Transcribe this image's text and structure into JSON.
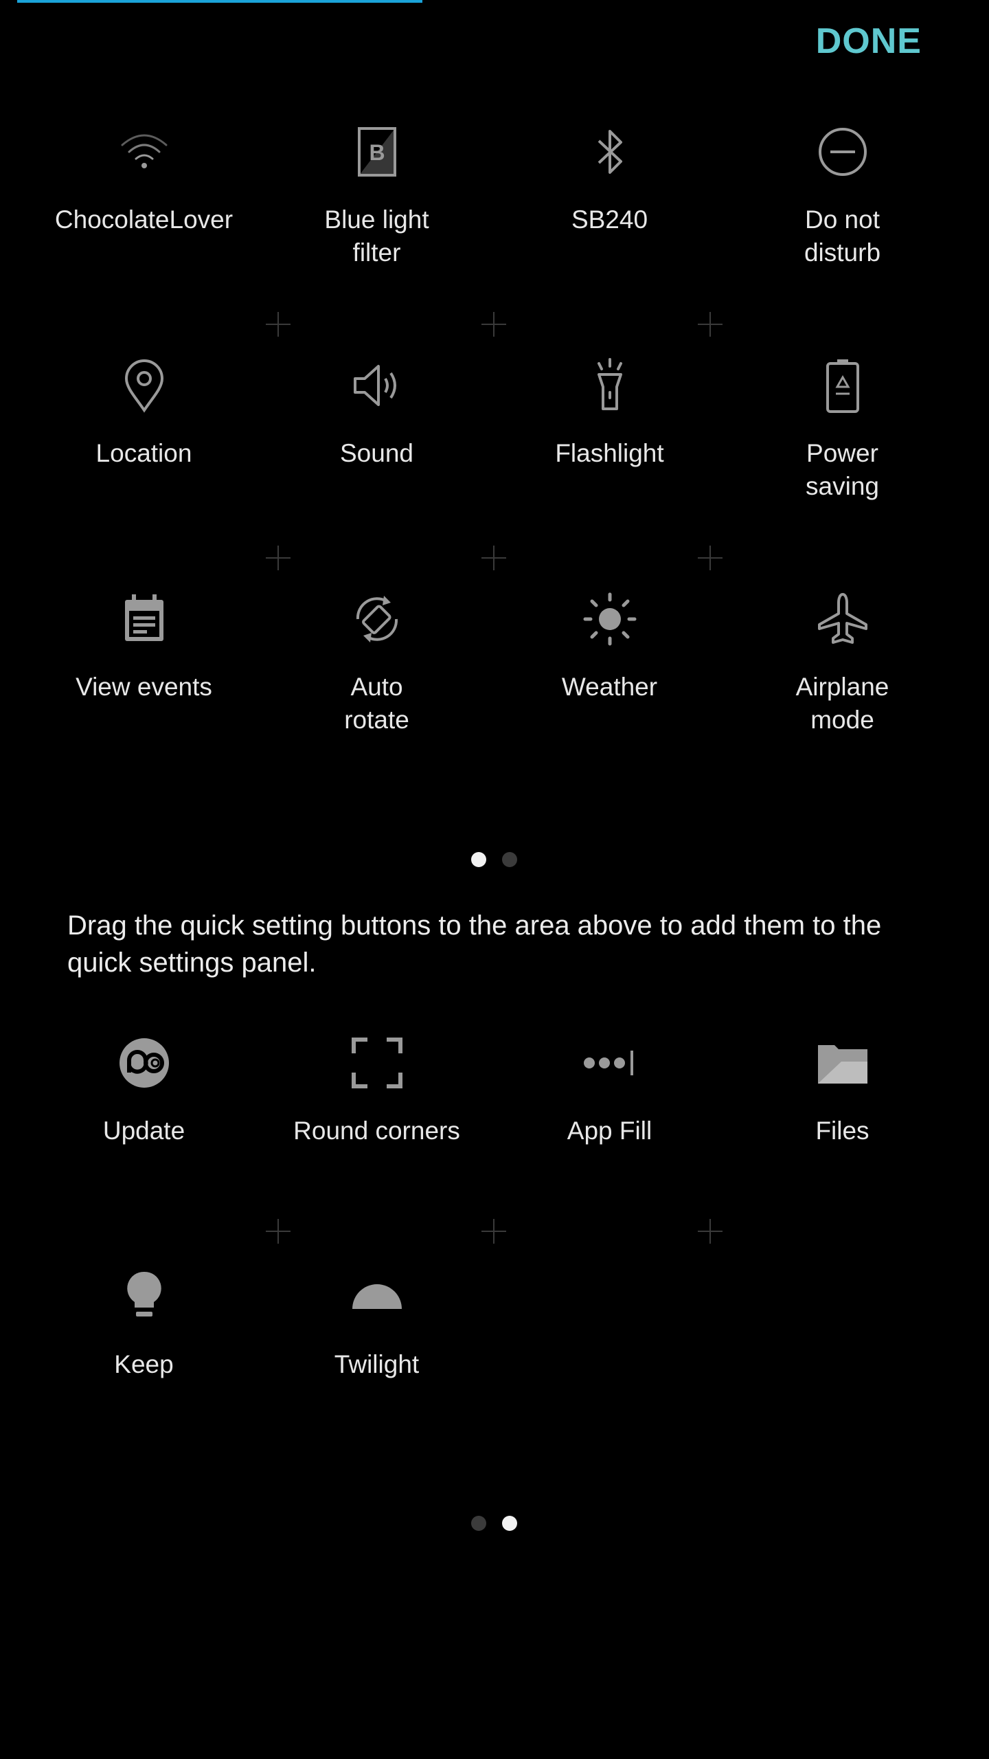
{
  "header": {
    "progress": 0.41,
    "done_label": "DONE"
  },
  "active_tiles": [
    {
      "label": "ChocolateLover",
      "icon": "wifi-icon"
    },
    {
      "label": "Blue light\nfilter",
      "icon": "blue-light-filter-icon"
    },
    {
      "label": "SB240",
      "icon": "bluetooth-icon"
    },
    {
      "label": "Do not\ndisturb",
      "icon": "do-not-disturb-icon"
    },
    {
      "label": "Location",
      "icon": "location-icon"
    },
    {
      "label": "Sound",
      "icon": "sound-icon"
    },
    {
      "label": "Flashlight",
      "icon": "flashlight-icon"
    },
    {
      "label": "Power\nsaving",
      "icon": "power-saving-icon"
    },
    {
      "label": "View events",
      "icon": "calendar-icon"
    },
    {
      "label": "Auto\nrotate",
      "icon": "auto-rotate-icon"
    },
    {
      "label": "Weather",
      "icon": "weather-icon"
    },
    {
      "label": "Airplane\nmode",
      "icon": "airplane-icon"
    }
  ],
  "top_pager": {
    "pages": 2,
    "active": 0
  },
  "instructions": "Drag the quick setting buttons to the area above to add them to the quick settings panel.",
  "available_tiles": [
    {
      "label": "Update",
      "icon": "update-icon"
    },
    {
      "label": "Round corners",
      "icon": "round-corners-icon"
    },
    {
      "label": "App Fill",
      "icon": "app-fill-icon"
    },
    {
      "label": "Files",
      "icon": "files-icon"
    },
    {
      "label": "Keep",
      "icon": "keep-icon"
    },
    {
      "label": "Twilight",
      "icon": "twilight-icon"
    }
  ],
  "bottom_pager": {
    "pages": 2,
    "active": 1
  },
  "colors": {
    "accent": "#5fc8cf",
    "progress": "#1aa3d9",
    "icon": "#9a9a9a",
    "background": "#000000"
  }
}
